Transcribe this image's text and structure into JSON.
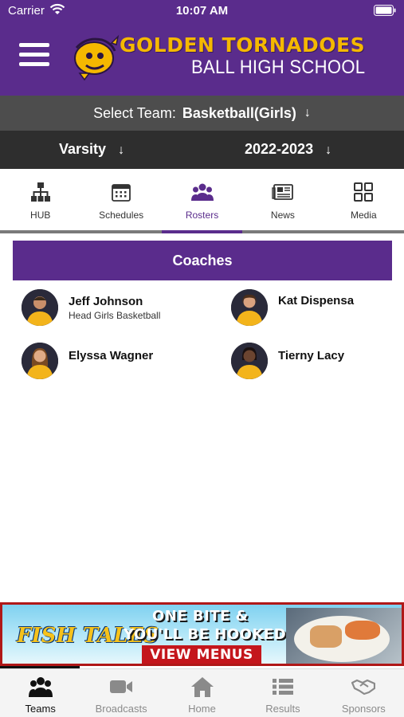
{
  "status_bar": {
    "carrier": "Carrier",
    "time": "10:07 AM"
  },
  "header": {
    "brand_title": "GOLDEN TORNADOES",
    "brand_subtitle": "BALL HIGH SCHOOL",
    "menu_icon": "hamburger-menu-icon"
  },
  "team_select": {
    "label": "Select Team:",
    "value": "Basketball(Girls)"
  },
  "filters": {
    "level": "Varsity",
    "season": "2022-2023"
  },
  "tabs": [
    {
      "label": "HUB",
      "icon": "hub-icon"
    },
    {
      "label": "Schedules",
      "icon": "calendar-icon"
    },
    {
      "label": "Rosters",
      "icon": "people-icon",
      "active": true
    },
    {
      "label": "News",
      "icon": "newspaper-icon"
    },
    {
      "label": "Media",
      "icon": "grid-icon"
    }
  ],
  "coaches_section": {
    "title": "Coaches",
    "coaches": [
      {
        "name": "Jeff Johnson",
        "title": "Head Girls Basketball"
      },
      {
        "name": "Kat Dispensa",
        "title": ""
      },
      {
        "name": "Elyssa Wagner",
        "title": ""
      },
      {
        "name": "Tierny Lacy",
        "title": ""
      }
    ]
  },
  "ad": {
    "brand": "FISH TALES",
    "line1": "ONE BITE &",
    "line2": "YOU'LL BE HOOKED",
    "cta": "VIEW MENUS"
  },
  "bottom_nav": [
    {
      "label": "Teams",
      "icon": "teams-icon",
      "active": true
    },
    {
      "label": "Broadcasts",
      "icon": "video-camera-icon"
    },
    {
      "label": "Home",
      "icon": "home-icon"
    },
    {
      "label": "Results",
      "icon": "list-icon"
    },
    {
      "label": "Sponsors",
      "icon": "handshake-icon"
    }
  ],
  "colors": {
    "brand_purple": "#5a2c8c",
    "brand_gold": "#f5b800",
    "team_bar": "#4d4d4d",
    "filter_bar": "#2e2e2e"
  }
}
